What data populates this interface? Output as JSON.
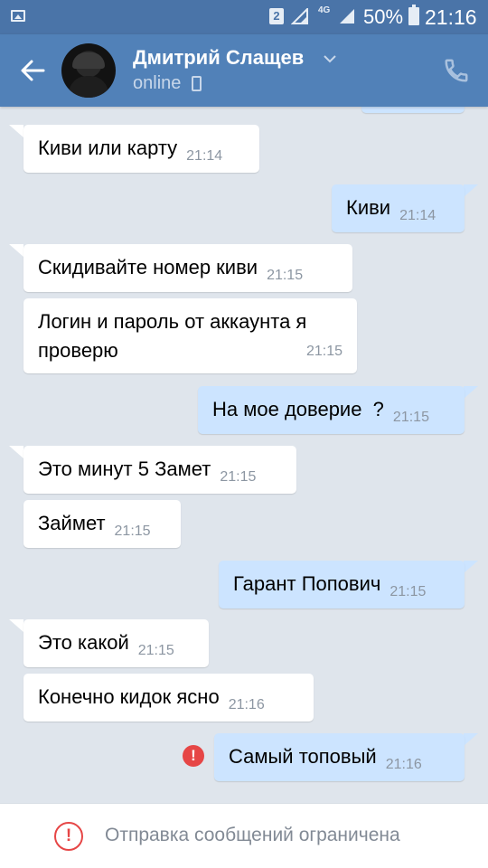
{
  "status_bar": {
    "sim_slot": "2",
    "network": "4G",
    "battery_percent": "50%",
    "time": "21:16"
  },
  "header": {
    "contact_name": "Дмитрий Слащев",
    "status": "online",
    "icons": [
      "back-arrow-icon",
      "chevron-down-icon",
      "mobile-icon",
      "phone-icon"
    ]
  },
  "messages": [
    {
      "dir": "in",
      "text": "Киви или карту",
      "time": "21:14"
    },
    {
      "dir": "out",
      "text": "Киви",
      "time": "21:14"
    },
    {
      "dir": "in",
      "text": "Скидивайте номер киви",
      "time": "21:15"
    },
    {
      "dir": "in",
      "text": "Логин и пароль от аккаунта я проверю",
      "time": "21:15"
    },
    {
      "dir": "out",
      "text": "На мое доверие  ?",
      "time": "21:15"
    },
    {
      "dir": "in",
      "text": "Это минут 5 Замет",
      "time": "21:15"
    },
    {
      "dir": "in",
      "text": "Займет",
      "time": "21:15"
    },
    {
      "dir": "out",
      "text": "Гарант Попович",
      "time": "21:15"
    },
    {
      "dir": "in",
      "text": "Это какой",
      "time": "21:15"
    },
    {
      "dir": "in",
      "text": "Конечно кидок ясно",
      "time": "21:16"
    },
    {
      "dir": "out",
      "text": "Самый топовый",
      "time": "21:16",
      "failed": true
    }
  ],
  "footer": {
    "text": "Отправка сообщений ограничена"
  },
  "colors": {
    "header": "#5181b8",
    "status_bar": "#4a74a8",
    "chat_bg": "#dfe5ec",
    "bubble_in": "#ffffff",
    "bubble_out": "#cce4ff",
    "error": "#e64646"
  }
}
